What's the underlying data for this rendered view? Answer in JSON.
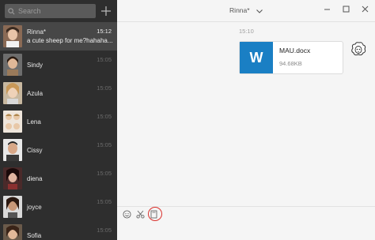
{
  "search": {
    "placeholder": "Search"
  },
  "conversations": [
    {
      "name": "Rinna*",
      "time": "15:12",
      "preview": "a cute sheep for me?hahaha...",
      "active": true
    },
    {
      "name": "Sindy",
      "time": "15:05"
    },
    {
      "name": "Azula",
      "time": "15:05"
    },
    {
      "name": "Lena",
      "time": "15:05"
    },
    {
      "name": "Cissy",
      "time": "15:05"
    },
    {
      "name": "diena",
      "time": "15:05"
    },
    {
      "name": "joyce",
      "time": "15:05"
    },
    {
      "name": "Sofia",
      "time": "15:05"
    }
  ],
  "chat": {
    "title": "Rinna*",
    "timestamp": "15:10",
    "file": {
      "icon_letter": "W",
      "name": "MAU.docx",
      "size": "94.68KB"
    }
  },
  "toolbar": {
    "icons": [
      "emoji-icon",
      "scissors-icon",
      "file-icon"
    ]
  },
  "colors": {
    "sidebar": "#2e2e2e",
    "active": "#474747",
    "word": "#1a7fc4",
    "highlight": "#d9302c"
  }
}
